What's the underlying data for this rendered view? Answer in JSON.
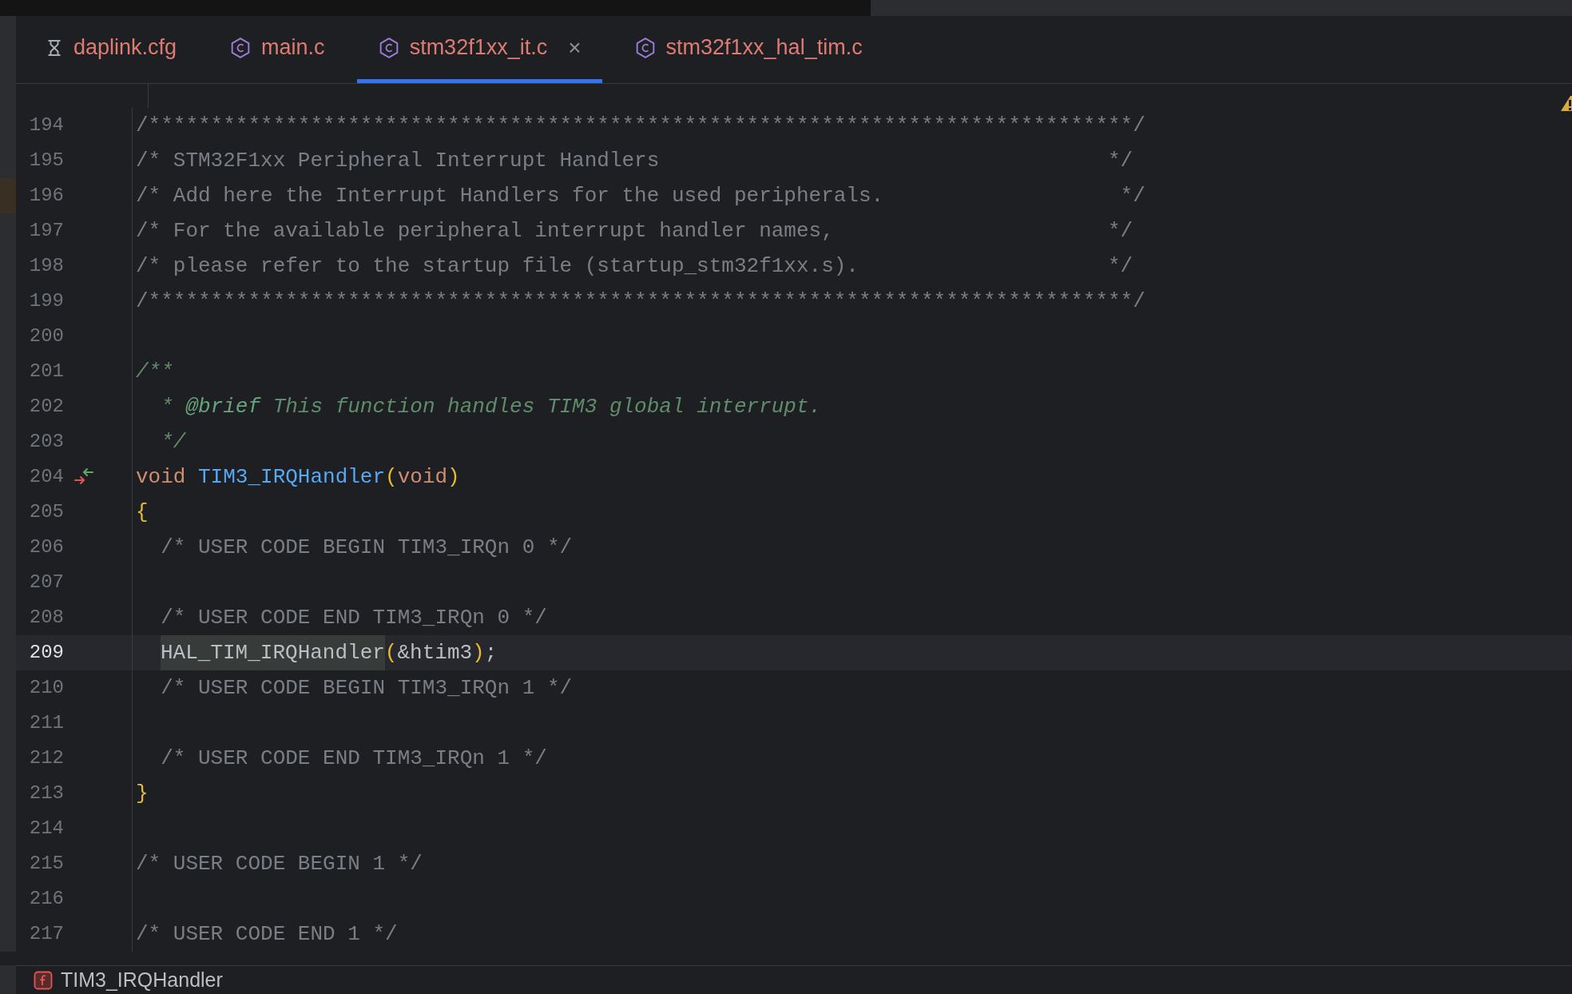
{
  "tabs": [
    {
      "label": "daplink.cfg",
      "kind": "config",
      "selected": false
    },
    {
      "label": "main.c",
      "kind": "c",
      "selected": false
    },
    {
      "label": "stm32f1xx_it.c",
      "kind": "c",
      "selected": true,
      "close": "×"
    },
    {
      "label": "stm32f1xx_hal_tim.c",
      "kind": "c",
      "selected": false
    }
  ],
  "editor": {
    "warning": true,
    "lines": [
      {
        "number": "194",
        "tokens": [
          {
            "text": "/*******************************************************************************/",
            "kind": "comment"
          }
        ]
      },
      {
        "number": "195",
        "tokens": [
          {
            "text": "/* STM32F1xx Peripheral Interrupt Handlers                                    */",
            "kind": "comment"
          }
        ]
      },
      {
        "number": "196",
        "changed": true,
        "tokens": [
          {
            "text": "/* Add here the Interrupt Handlers for the used peripherals.                   */",
            "kind": "comment"
          }
        ]
      },
      {
        "number": "197",
        "tokens": [
          {
            "text": "/* For the available peripheral interrupt handler names,                      */",
            "kind": "comment"
          }
        ]
      },
      {
        "number": "198",
        "tokens": [
          {
            "text": "/* please refer to the startup file (startup_stm32f1xx.s).                    */",
            "kind": "comment"
          }
        ]
      },
      {
        "number": "199",
        "tokens": [
          {
            "text": "/*******************************************************************************/",
            "kind": "comment"
          }
        ]
      },
      {
        "number": "200"
      },
      {
        "number": "201",
        "tokens": [
          {
            "text": "/**",
            "kind": "doc"
          }
        ]
      },
      {
        "number": "202",
        "tokens": [
          {
            "text": "  * ",
            "kind": "doc"
          },
          {
            "text": "@brief",
            "kind": "doctag"
          },
          {
            "text": " This function handles TIM3 global interrupt.",
            "kind": "doc"
          }
        ]
      },
      {
        "number": "203",
        "tokens": [
          {
            "text": "  */",
            "kind": "doc"
          }
        ]
      },
      {
        "number": "204",
        "implemented": true,
        "tokens": [
          {
            "text": "void ",
            "kind": "keyword"
          },
          {
            "text": "TIM3_IRQHandler",
            "kind": "function"
          },
          {
            "text": "(",
            "kind": "brace"
          },
          {
            "text": "void",
            "kind": "keyword"
          },
          {
            "text": ")",
            "kind": "brace"
          }
        ]
      },
      {
        "number": "205",
        "tokens": [
          {
            "text": "{",
            "kind": "brace"
          }
        ]
      },
      {
        "number": "206",
        "tokens": [
          {
            "text": "  /* USER CODE BEGIN TIM3_IRQn 0 */",
            "kind": "comment"
          }
        ]
      },
      {
        "number": "207"
      },
      {
        "number": "208",
        "tokens": [
          {
            "text": "  /* USER CODE END TIM3_IRQn 0 */",
            "kind": "comment"
          }
        ]
      },
      {
        "number": "209",
        "current": true,
        "indented": true,
        "tokens": [
          {
            "text": "HAL_TIM_IRQHandler",
            "kind": "usage"
          },
          {
            "text": "(",
            "kind": "brace"
          },
          {
            "text": "&htim3",
            "kind": "plain"
          },
          {
            "text": ")",
            "kind": "brace"
          },
          {
            "text": ";",
            "kind": "plain"
          }
        ]
      },
      {
        "number": "210",
        "tokens": [
          {
            "text": "  /* USER CODE BEGIN TIM3_IRQn 1 */",
            "kind": "comment"
          }
        ]
      },
      {
        "number": "211"
      },
      {
        "number": "212",
        "tokens": [
          {
            "text": "  /* USER CODE END TIM3_IRQn 1 */",
            "kind": "comment"
          }
        ]
      },
      {
        "number": "213",
        "tokens": [
          {
            "text": "}",
            "kind": "brace"
          }
        ]
      },
      {
        "number": "214"
      },
      {
        "number": "215",
        "tokens": [
          {
            "text": "/* USER CODE BEGIN 1 */",
            "kind": "comment"
          }
        ]
      },
      {
        "number": "216"
      },
      {
        "number": "217",
        "tokens": [
          {
            "text": "/* USER CODE END 1 */",
            "kind": "comment"
          }
        ]
      }
    ]
  },
  "breadcrumb": {
    "label": "TIM3_IRQHandler"
  }
}
